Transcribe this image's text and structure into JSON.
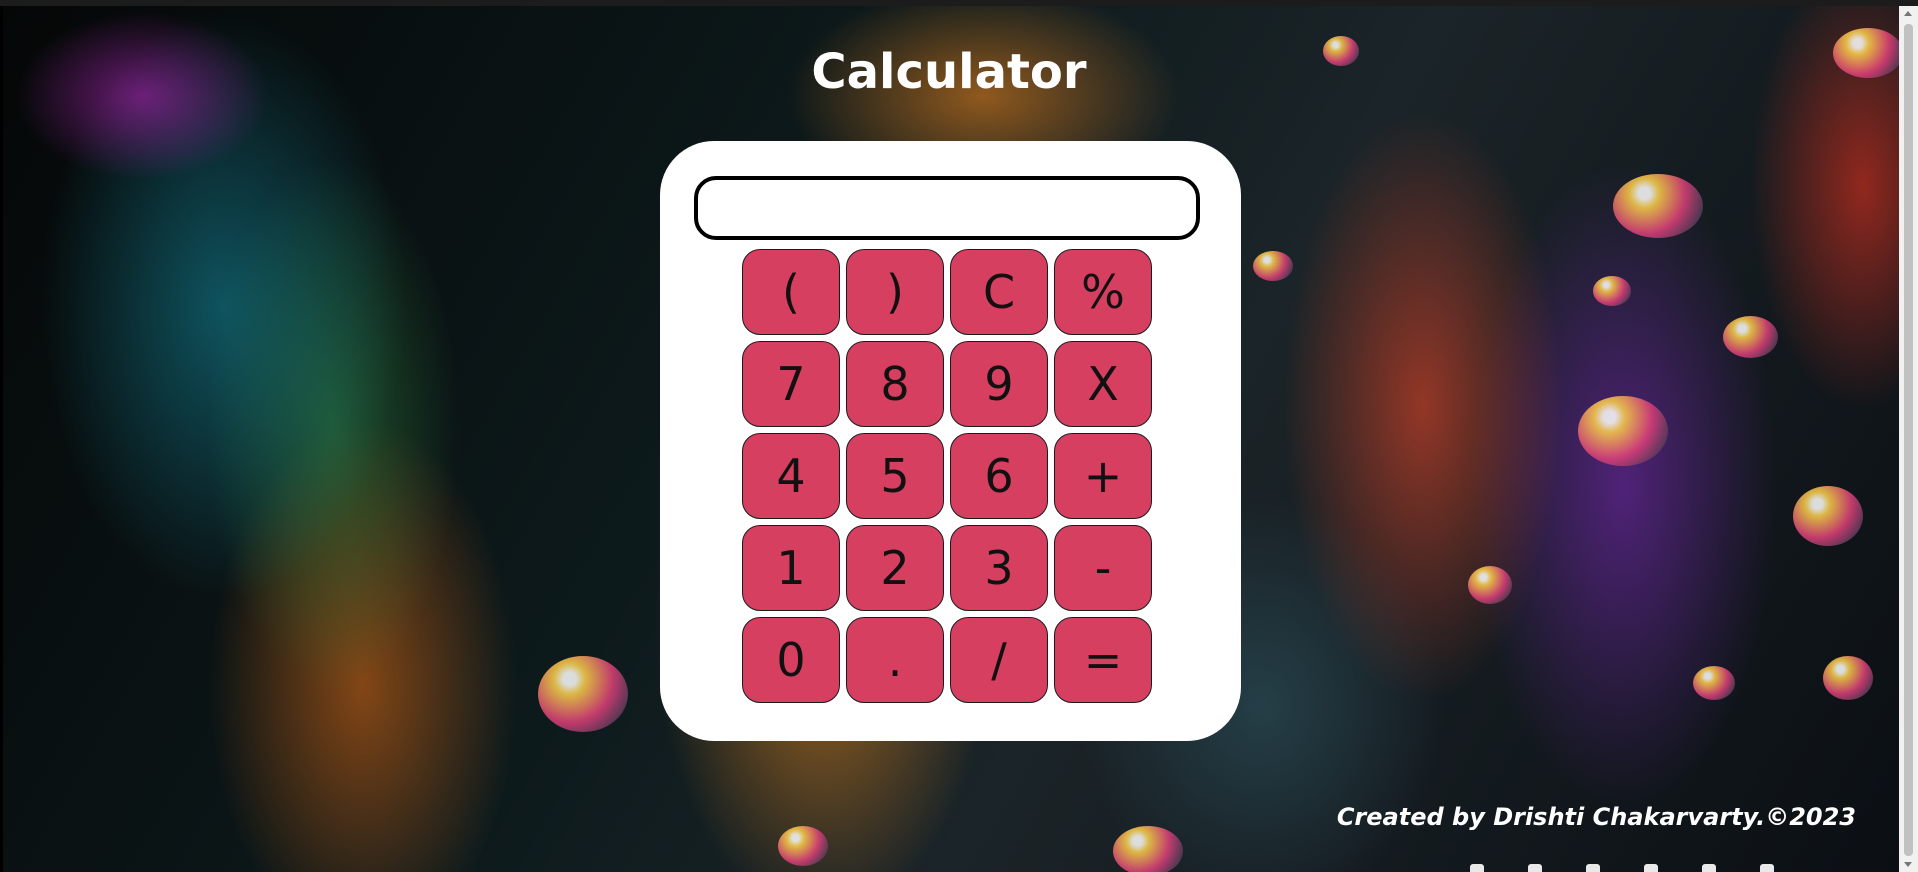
{
  "page": {
    "title": "Calculator",
    "footer": "Created by Drishti Chakarvarty.©2023"
  },
  "calculator": {
    "display_value": "",
    "buttons": [
      {
        "label": "("
      },
      {
        "label": ")"
      },
      {
        "label": "C"
      },
      {
        "label": "%"
      },
      {
        "label": "7"
      },
      {
        "label": "8"
      },
      {
        "label": "9"
      },
      {
        "label": "X"
      },
      {
        "label": "4"
      },
      {
        "label": "5"
      },
      {
        "label": "6"
      },
      {
        "label": "+"
      },
      {
        "label": "1"
      },
      {
        "label": "2"
      },
      {
        "label": "3"
      },
      {
        "label": "-"
      },
      {
        "label": "0"
      },
      {
        "label": "."
      },
      {
        "label": "/"
      },
      {
        "label": "="
      }
    ]
  },
  "footer_icons": [
    "facebook-icon",
    "twitter-icon",
    "instagram-icon",
    "linkedin-icon",
    "github-icon",
    "mail-icon"
  ],
  "colors": {
    "button": "#d63f5f",
    "calculator_body": "#ffffff",
    "title_text": "#ffffff"
  }
}
